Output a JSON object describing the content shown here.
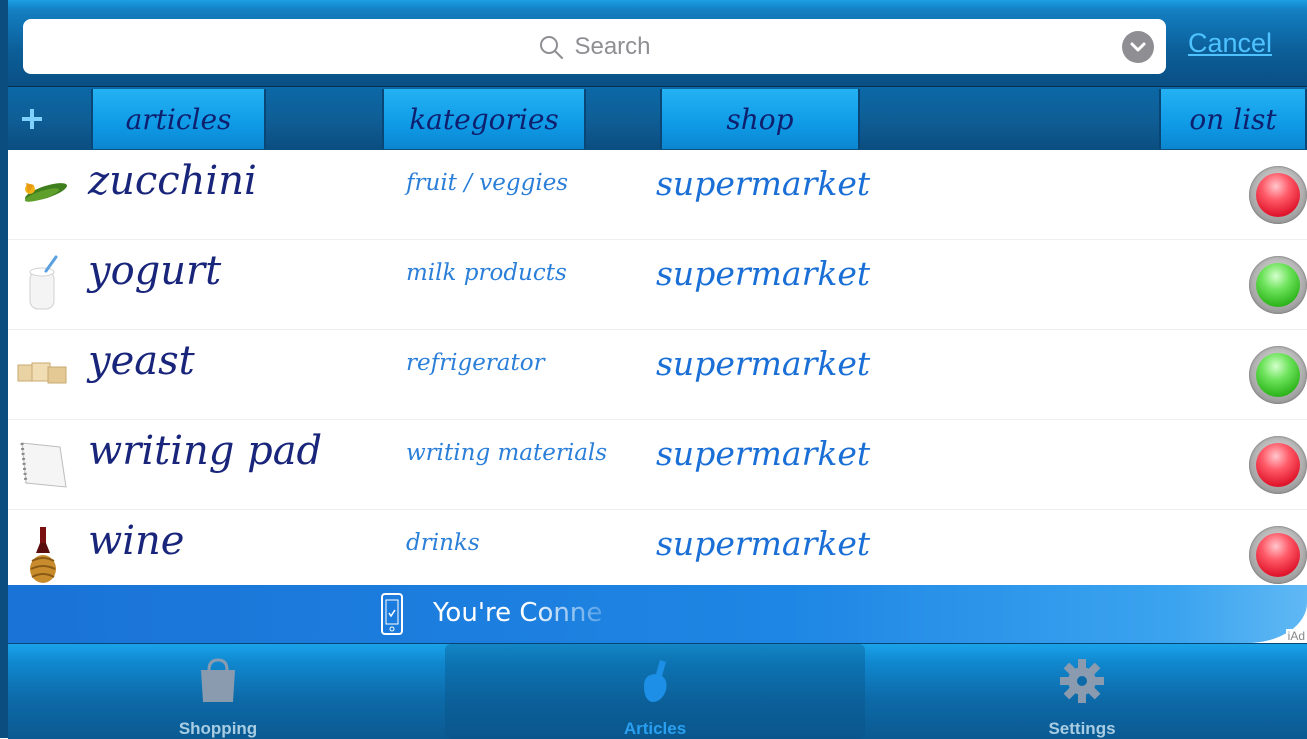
{
  "search": {
    "placeholder": "Search",
    "cancel_label": "Cancel"
  },
  "header": {
    "add_label": "+",
    "columns": [
      {
        "label": "articles"
      },
      {
        "label": "kategories"
      },
      {
        "label": "shop"
      },
      {
        "label": "on list"
      }
    ]
  },
  "items": [
    {
      "name": "zucchini",
      "category": "fruit / veggies",
      "shop": "supermarket",
      "on_list": "red",
      "icon": "zucchini-icon"
    },
    {
      "name": "yogurt",
      "category": "milk products",
      "shop": "supermarket",
      "on_list": "green",
      "icon": "yogurt-icon"
    },
    {
      "name": "yeast",
      "category": "refrigerator",
      "shop": "supermarket",
      "on_list": "green",
      "icon": "yeast-icon"
    },
    {
      "name": "writing pad",
      "category": "writing materials",
      "shop": "supermarket",
      "on_list": "red",
      "icon": "writing-pad-icon"
    },
    {
      "name": "wine",
      "category": "drinks",
      "shop": "supermarket",
      "on_list": "red",
      "icon": "wine-icon"
    }
  ],
  "ad": {
    "text": "You're Conne",
    "badge": "iAd"
  },
  "tabs": [
    {
      "label": "Shopping",
      "icon": "shopping-bag-icon"
    },
    {
      "label": "Articles",
      "icon": "articles-icon",
      "selected": true
    },
    {
      "label": "Settings",
      "icon": "gear-icon"
    }
  ],
  "colors": {
    "accent": "#1a8fe0",
    "item_name": "#18257a",
    "category_text": "#2b7fd8",
    "shop_text": "#1a6fd6",
    "status_red": "#e0162c",
    "status_green": "#2fb61d"
  }
}
